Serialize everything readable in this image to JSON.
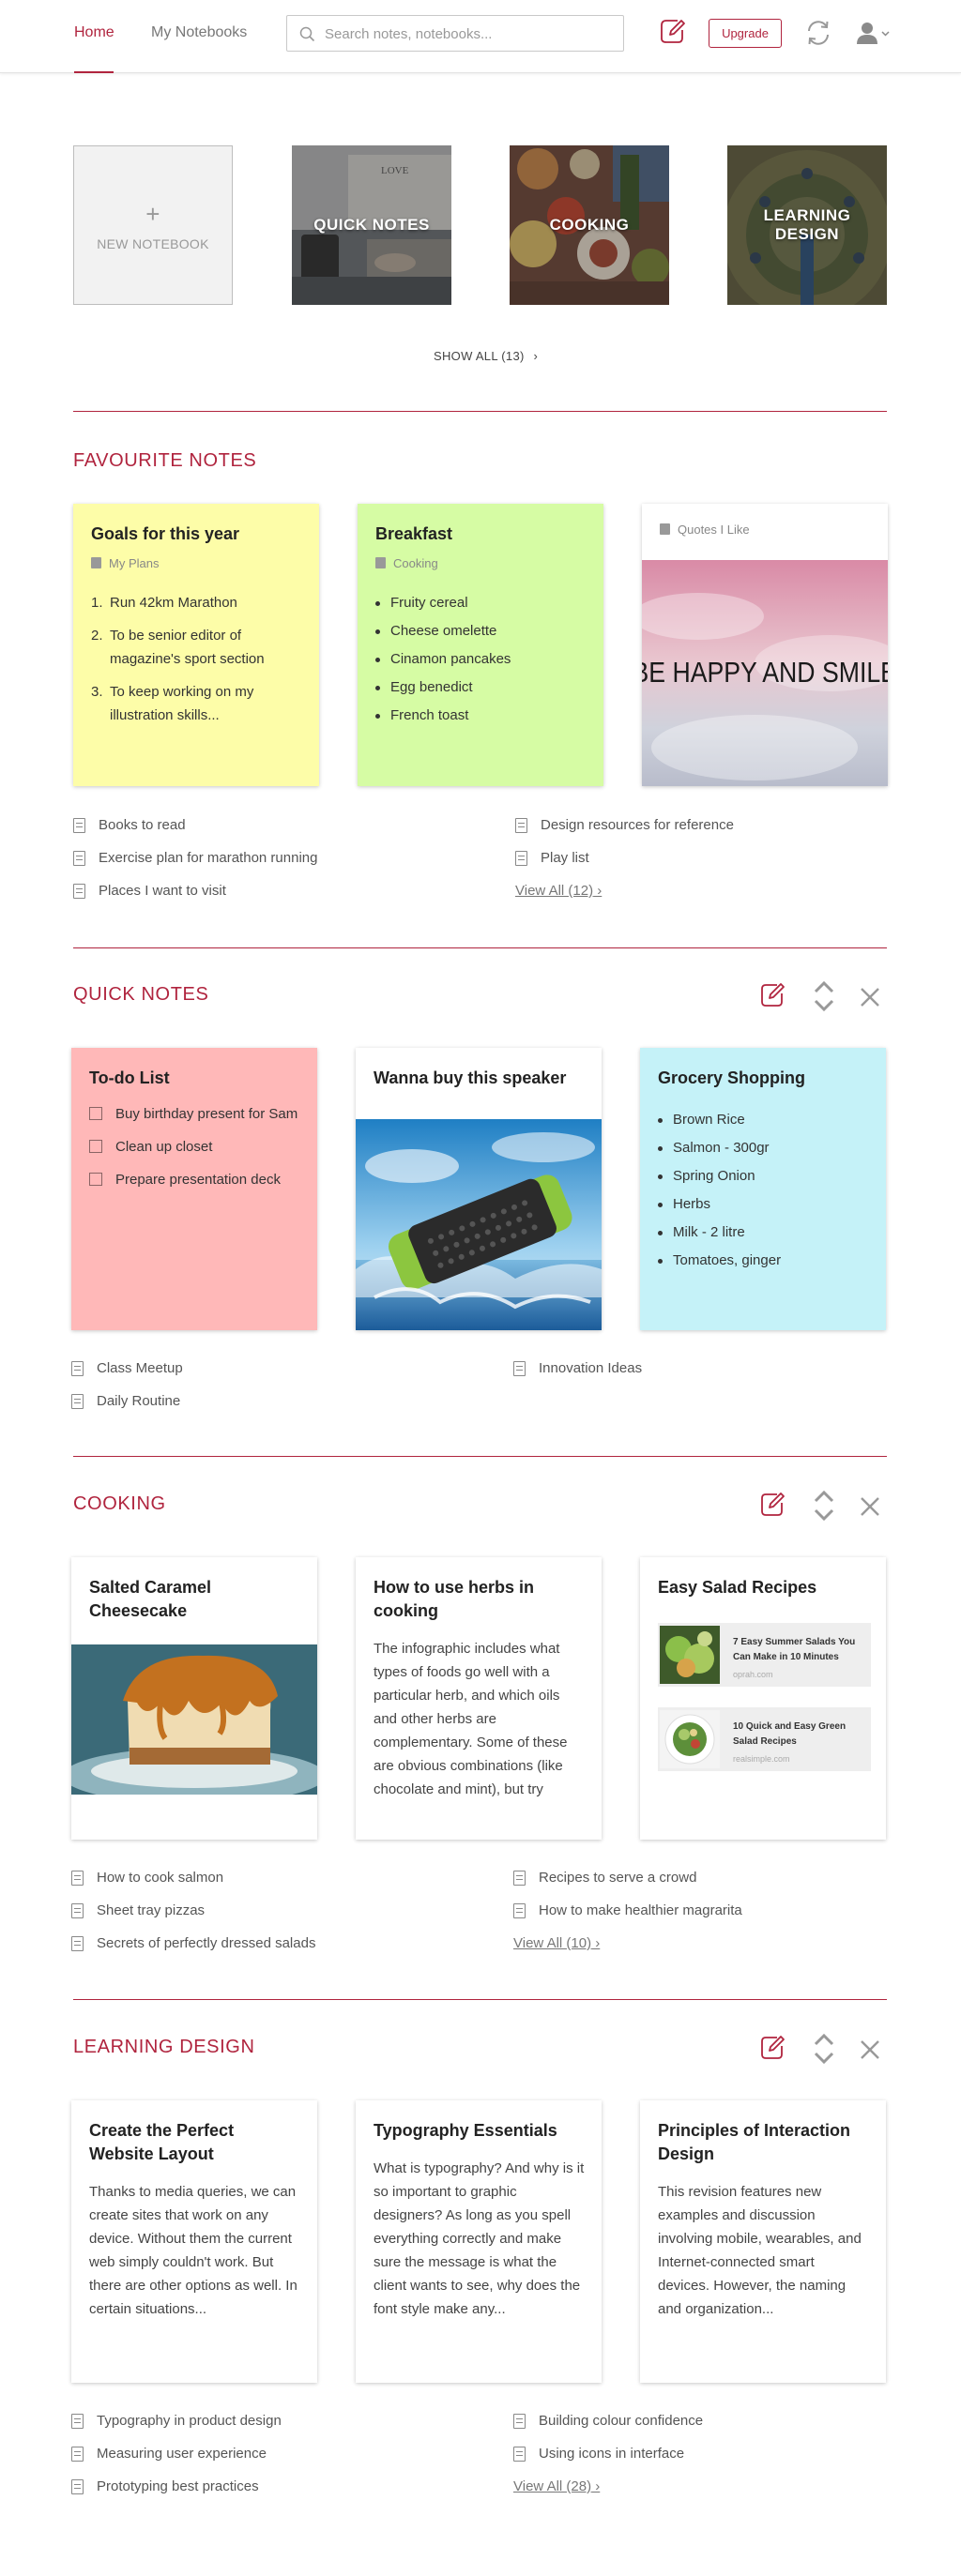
{
  "header": {
    "tabs": [
      {
        "label": "Home"
      },
      {
        "label": "My Notebooks"
      }
    ],
    "search_placeholder": "Search notes, notebooks...",
    "upgrade_label": "Upgrade",
    "accent_color": "#b0243e"
  },
  "notebooks": {
    "new_label": "NEW NOTEBOOK",
    "items": [
      {
        "label": "QUICK NOTES"
      },
      {
        "label": "COOKING"
      },
      {
        "label": "LEARNING DESIGN"
      }
    ],
    "show_all": "SHOW ALL (13)"
  },
  "favourites": {
    "title": "FAVOURITE NOTES",
    "cards": [
      {
        "title": "Goals for this year",
        "notebook": "My Plans",
        "items": [
          "Run 42km Marathon",
          "To be senior editor of magazine's  sport section",
          "To keep working on my illustration skills..."
        ]
      },
      {
        "title": "Breakfast",
        "notebook": "Cooking",
        "items": [
          "Fruity cereal",
          "Cheese omelette",
          "Cinamon pancakes",
          "Egg benedict",
          "French toast"
        ]
      },
      {
        "notebook": "Quotes I Like",
        "image_text": "BE HAPPY AND SMILE"
      }
    ],
    "notes_left": [
      "Books to read",
      "Exercise plan for marathon running",
      "Places I want to visit"
    ],
    "notes_right": [
      "Design resources for reference",
      "Play list"
    ],
    "view_all": "View All (12)"
  },
  "quick_notes": {
    "title": "QUICK NOTES",
    "cards": [
      {
        "title": "To-do List",
        "items": [
          "Buy birthday present for Sam",
          "Clean up closet",
          "Prepare presentation deck"
        ]
      },
      {
        "title": "Wanna buy this speaker"
      },
      {
        "title": "Grocery Shopping",
        "items": [
          "Brown Rice",
          "Salmon - 300gr",
          "Spring Onion",
          "Herbs",
          "Milk - 2 litre",
          "Tomatoes, ginger"
        ]
      }
    ],
    "notes_left": [
      "Class Meetup",
      "Daily Routine"
    ],
    "notes_right": [
      "Innovation Ideas"
    ]
  },
  "cooking": {
    "title": "COOKING",
    "cards": [
      {
        "title": "Salted Caramel Cheesecake"
      },
      {
        "title": "How to use herbs in cooking",
        "body": "The infographic includes what types of foods go well with a particular herb, and which oils and other herbs are complementary. Some of these are obvious combinations (like chocolate and mint), but try"
      },
      {
        "title": "Easy Salad Recipes",
        "links": [
          {
            "title": "7 Easy Summer Salads You Can Make in 10 Minutes",
            "source": "oprah.com"
          },
          {
            "title": "10 Quick and Easy Green Salad Recipes",
            "source": "realsimple.com"
          }
        ]
      }
    ],
    "notes_left": [
      "How to cook salmon",
      "Sheet tray pizzas",
      "Secrets of perfectly dressed salads"
    ],
    "notes_right": [
      "Recipes to serve a crowd",
      "How to make healthier magrarita"
    ],
    "view_all": "View All (10)"
  },
  "learning": {
    "title": "LEARNING DESIGN",
    "cards": [
      {
        "title": "Create the Perfect Website Layout",
        "body": "Thanks to media queries, we can create sites that work on any device. Without them the current web simply couldn't work. But there are other options as well. In certain situations..."
      },
      {
        "title": "Typography Essentials",
        "body": "What is typography? And why is it so important to graphic designers? As long as you spell everything correctly and make sure the message is what the client wants to see, why does the font style make any..."
      },
      {
        "title": "Principles of Interaction Design",
        "body": "This revision features new examples and discussion involving mobile, wearables, and Internet-connected smart devices. However, the naming and organization..."
      }
    ],
    "notes_left": [
      "Typography in product design",
      "Measuring user experience",
      "Prototyping best practices"
    ],
    "notes_right": [
      "Building colour confidence",
      "Using icons in interface"
    ],
    "view_all": "View All (28)"
  }
}
